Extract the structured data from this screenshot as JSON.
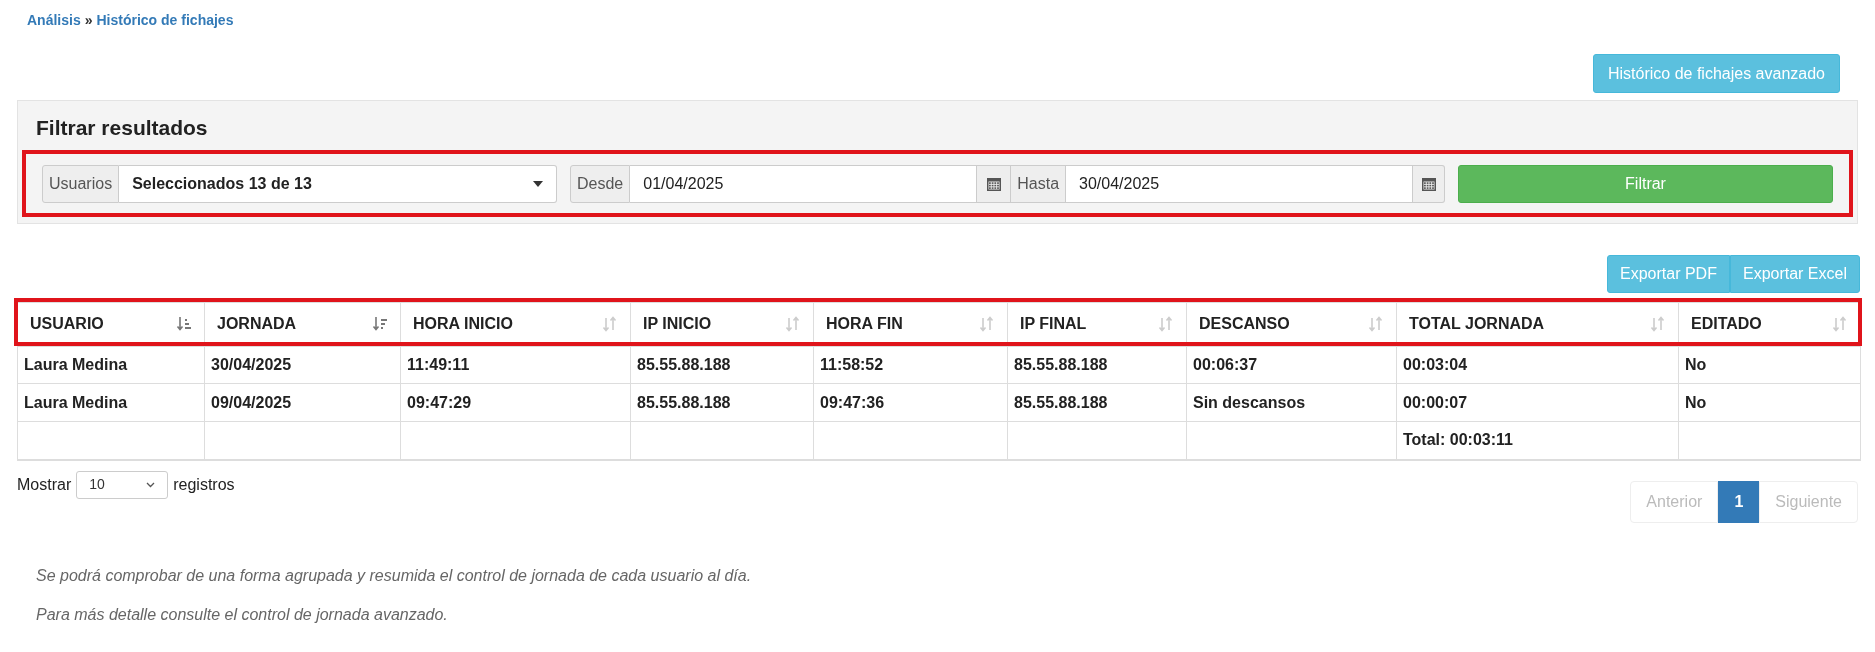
{
  "breadcrumb": [
    {
      "label": "Análisis"
    },
    {
      "separator": "»"
    },
    {
      "label": "Histórico de fichajes"
    }
  ],
  "advanced_button": "Histórico de fichajes avanzado",
  "filter": {
    "title": "Filtrar resultados",
    "highlighted": true,
    "users": {
      "label": "Usuarios",
      "value": "Seleccionados 13 de 13"
    },
    "from": {
      "label": "Desde",
      "value": "01/04/2025"
    },
    "to": {
      "label": "Hasta",
      "value": "30/04/2025"
    },
    "submit": "Filtrar"
  },
  "export_buttons": [
    "Exportar PDF",
    "Exportar Excel"
  ],
  "table": {
    "header_highlighted": true,
    "columns": [
      {
        "label": "USUARIO",
        "sorted_ascending": true,
        "sorted_descending": false
      },
      {
        "label": "JORNADA",
        "sorted_ascending": false,
        "sorted_descending": true
      },
      {
        "label": "HORA INICIO",
        "sorted_ascending": false,
        "sorted_descending": false
      },
      {
        "label": "IP INICIO",
        "sorted_ascending": false,
        "sorted_descending": false
      },
      {
        "label": "HORA FIN",
        "sorted_ascending": false,
        "sorted_descending": false
      },
      {
        "label": "IP FINAL",
        "sorted_ascending": false,
        "sorted_descending": false
      },
      {
        "label": "DESCANSO",
        "sorted_ascending": false,
        "sorted_descending": false
      },
      {
        "label": "TOTAL JORNADA",
        "sorted_ascending": false,
        "sorted_descending": false
      },
      {
        "label": "EDITADO",
        "sorted_ascending": false,
        "sorted_descending": false
      }
    ],
    "rows": [
      [
        "Laura Medina",
        "30/04/2025",
        "11:49:11",
        "85.55.88.188",
        "11:58:52",
        "85.55.88.188",
        "00:06:37",
        "00:03:04",
        "No"
      ],
      [
        "Laura Medina",
        "09/04/2025",
        "09:47:29",
        "85.55.88.188",
        "09:47:36",
        "85.55.88.188",
        "Sin descansos",
        "00:00:07",
        "No"
      ]
    ],
    "footer": {
      "total_jornada": "Total: 00:03:11"
    }
  },
  "page_size": {
    "before": "Mostrar",
    "value": "10",
    "after": "registros"
  },
  "pagination": [
    {
      "label": "Anterior",
      "disabled": true,
      "selected": false
    },
    {
      "label": "1",
      "disabled": false,
      "selected": true
    },
    {
      "label": "Siguiente",
      "disabled": true,
      "selected": false
    }
  ],
  "notes": [
    "Se podrá comprobar de una forma agrupada y resumida el control de jornada de cada usuario al día.",
    "Para más detalle consulte el control de jornada avanzado."
  ]
}
